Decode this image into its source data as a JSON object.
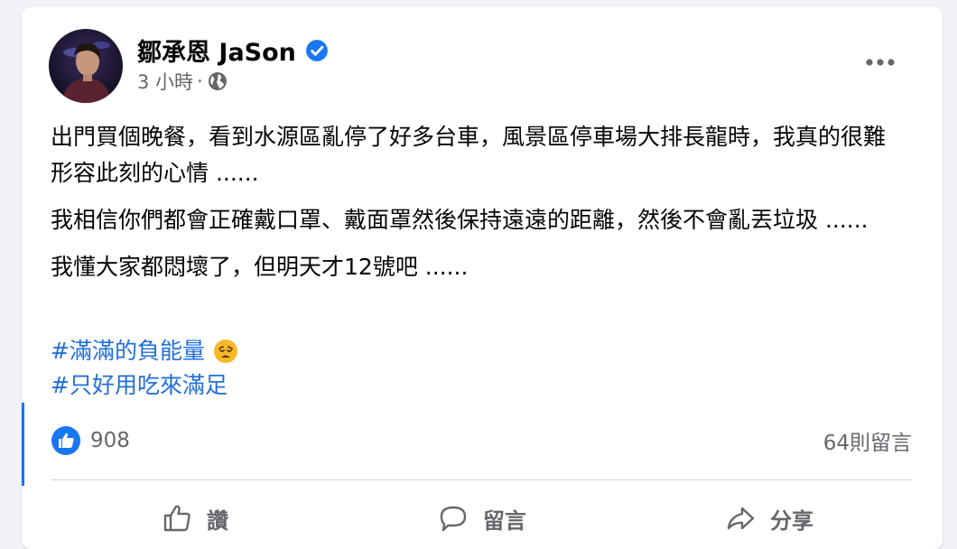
{
  "post": {
    "author": "鄒承恩 JaSon",
    "time": "3 小時",
    "separator": "·",
    "paragraphs": [
      "出門買個晚餐，看到水源區亂停了好多台車，風景區停車場大排長龍時，我真的很難形容此刻的心情 ......",
      "我相信你們都會正確戴口罩、戴面罩然後保持遠遠的距離，然後不會亂丟垃圾 ......",
      "我懂大家都悶壞了，但明天才12號吧 ......"
    ],
    "hashtags": [
      {
        "text": "#滿滿的負能量",
        "emoji": "weary-face-emoji"
      },
      {
        "text": "#只好用吃來滿足"
      }
    ]
  },
  "stats": {
    "likes": "908",
    "comments": "64則留言"
  },
  "actions": {
    "like": "讚",
    "comment": "留言",
    "share": "分享"
  },
  "colors": {
    "brand_blue": "#1877f2",
    "hashtag_blue": "#216fdb",
    "secondary_text": "#65676b"
  }
}
